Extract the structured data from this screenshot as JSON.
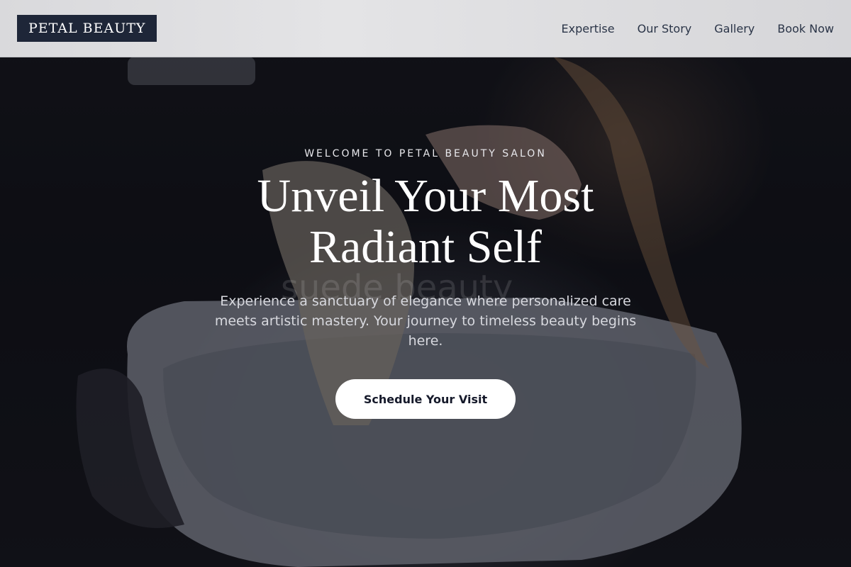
{
  "header": {
    "logo": "PETAL BEAUTY",
    "nav": [
      {
        "label": "Expertise"
      },
      {
        "label": "Our Story"
      },
      {
        "label": "Gallery"
      },
      {
        "label": "Book Now"
      }
    ]
  },
  "hero": {
    "eyebrow": "WELCOME TO PETAL BEAUTY SALON",
    "headline": "Unveil Your Most Radiant Self",
    "subtext": "Experience a sanctuary of elegance where personalized care meets artistic mastery. Your journey to timeless beauty begins here.",
    "cta_label": "Schedule Your Visit",
    "photo_watermark": "suede beauty"
  },
  "colors": {
    "logo_bg": "#1e2638",
    "nav_text": "#2a3447",
    "cta_bg": "#ffffff",
    "cta_text": "#15192a"
  }
}
